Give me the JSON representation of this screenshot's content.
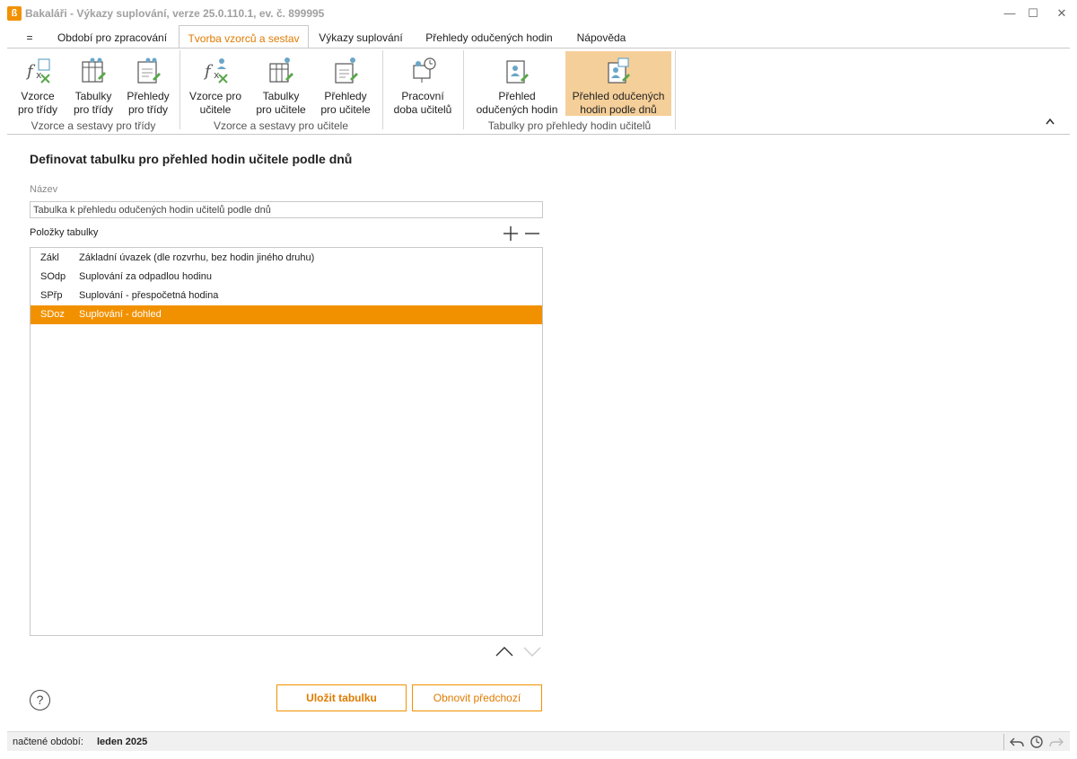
{
  "window": {
    "title": "Bakaláři - Výkazy suplování, verze 25.0.110.1, ev. č. 899995",
    "app_icon": "bakalari-logo-icon",
    "minimize": "—",
    "maximize": "☐",
    "close": "✕"
  },
  "menu": {
    "hamburger": "=",
    "tabs": [
      {
        "label": "Období pro zpracování"
      },
      {
        "label": "Tvorba vzorců a sestav"
      },
      {
        "label": "Výkazy suplování"
      },
      {
        "label": "Přehledy odučených hodin"
      },
      {
        "label": "Nápověda"
      }
    ],
    "active_tab": "Tvorba vzorců a sestav"
  },
  "ribbon": {
    "groups": [
      {
        "label": "Vzorce a sestavy pro třídy",
        "buttons": [
          {
            "label1": "Vzorce",
            "label2": "pro třídy",
            "icon": "formula-icon"
          },
          {
            "label1": "Tabulky",
            "label2": "pro třídy",
            "icon": "table-icon"
          },
          {
            "label1": "Přehledy",
            "label2": "pro třídy",
            "icon": "report-icon"
          }
        ]
      },
      {
        "label": "Vzorce a sestavy pro učitele",
        "buttons": [
          {
            "label1": "Vzorce pro",
            "label2": "učitele",
            "icon": "formula-teacher-icon"
          },
          {
            "label1": "Tabulky",
            "label2": "pro učitele",
            "icon": "table-teacher-icon"
          },
          {
            "label1": "Přehledy",
            "label2": "pro učitele",
            "icon": "report-teacher-icon"
          }
        ]
      },
      {
        "label": "",
        "buttons": [
          {
            "label1": "Pracovní",
            "label2": "doba učitelů",
            "icon": "teacher-clock-icon"
          }
        ]
      },
      {
        "label": "Tabulky pro přehledy hodin učitelů",
        "buttons": [
          {
            "label1": "Přehled",
            "label2": "odučených hodin",
            "icon": "hours-overview-icon"
          },
          {
            "label1": "Přehled odučených",
            "label2": "hodin podle dnů",
            "icon": "hours-by-day-icon"
          }
        ]
      }
    ],
    "collapse_glyph": "^"
  },
  "content": {
    "title": "Definovat tabulku pro přehled hodin učitele podle dnů",
    "name_label": "Název",
    "name_value": "Tabulka k přehledu odučených hodin učitelů podle dnů",
    "items_label": "Položky tabulky",
    "add_glyph": "+",
    "remove_glyph": "—",
    "items": [
      {
        "code": "Zákl",
        "description": "Základní úvazek (dle rozvrhu, bez hodin jiného druhu)"
      },
      {
        "code": "SOdp",
        "description": "Suplování za odpadlou hodinu"
      },
      {
        "code": "SPřp",
        "description": "Suplování - přespočetná hodina"
      },
      {
        "code": "SDoz",
        "description": "Suplování - dohled"
      }
    ],
    "selected_item": "SDoz",
    "help_glyph": "?",
    "save_button": "Uložit tabulku",
    "restore_button": "Obnovit předchozí"
  },
  "status": {
    "label": "načtené období:",
    "value": "leden 2025"
  },
  "colors": {
    "accent": "#f29100",
    "accent_text": "#e07b00",
    "ribbon_selected": "#f5cf9a"
  }
}
